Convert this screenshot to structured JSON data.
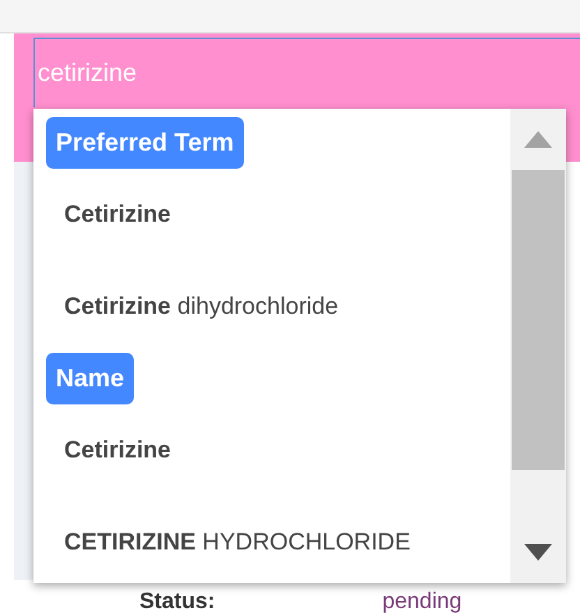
{
  "search": {
    "value": "cetirizine"
  },
  "groups": [
    {
      "label": "Preferred Term",
      "items": [
        "**Cetirizine**",
        "**Cetirizine** dihydrochloride"
      ]
    },
    {
      "label": "Name",
      "items": [
        "**Cetirizine**",
        "**CETIRIZINE** HYDROCHLORIDE"
      ]
    }
  ],
  "details": [
    {
      "label": "Status:",
      "value": "pending"
    }
  ]
}
